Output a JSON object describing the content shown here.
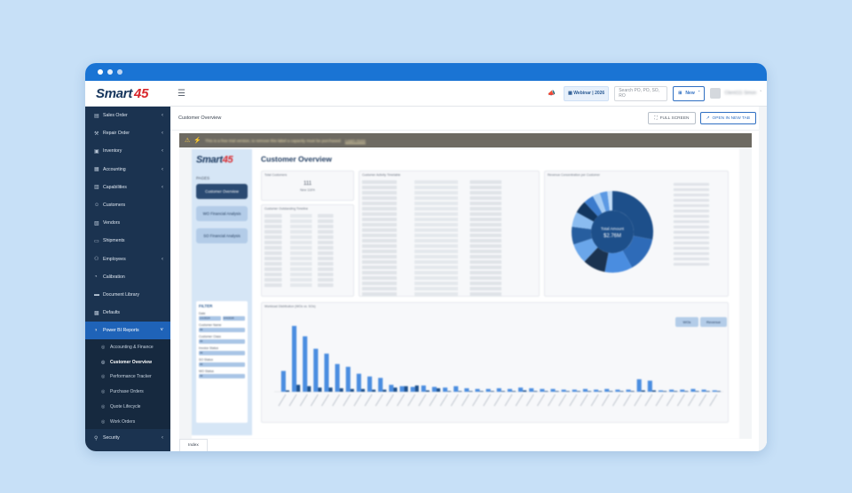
{
  "topbar": {
    "logo_text": "Smart",
    "logo_accent": "45",
    "menu_icon": "hamburger-icon",
    "webinar_label": "Webinar | 2026",
    "search_placeholder": "Search PO, PO, SO, RO",
    "new_label": "New",
    "user_name": "Client111 Simon"
  },
  "sidebar": {
    "items": [
      {
        "label": "Sales Order",
        "icon": "cart-icon",
        "expandable": true
      },
      {
        "label": "Repair Order",
        "icon": "wrench-icon",
        "expandable": true
      },
      {
        "label": "Inventory",
        "icon": "box-icon",
        "expandable": true
      },
      {
        "label": "Accounting",
        "icon": "calculator-icon",
        "expandable": true
      },
      {
        "label": "Capabilities",
        "icon": "clipboard-icon",
        "expandable": true
      },
      {
        "label": "Customers",
        "icon": "people-icon",
        "expandable": false
      },
      {
        "label": "Vendors",
        "icon": "store-icon",
        "expandable": false
      },
      {
        "label": "Shipments",
        "icon": "truck-icon",
        "expandable": false
      },
      {
        "label": "Employees",
        "icon": "users-icon",
        "expandable": true
      },
      {
        "label": "Calibration",
        "icon": "gauge-icon",
        "expandable": false
      },
      {
        "label": "Document Library",
        "icon": "folder-icon",
        "expandable": false
      },
      {
        "label": "Defaults",
        "icon": "grid-icon",
        "expandable": false
      },
      {
        "label": "Power BI Reports",
        "icon": "chart-icon",
        "expandable": true
      }
    ],
    "sub_items": [
      "Accounting & Finance",
      "Customer Overview",
      "Performance Tracker",
      "Purchase Orders",
      "Quote Lifecycle",
      "Work Orders"
    ],
    "footer_item": "Security"
  },
  "main": {
    "page_title": "Customer Overview",
    "fullscreen_label": "FULL SCREEN",
    "open_new_tab_label": "OPEN IN NEW TAB",
    "banner_text": "This is a free trial version, to remove this label a capacity must be purchased.",
    "banner_link": "Learn more",
    "tab_label": "Index"
  },
  "report": {
    "logo_text": "Smart",
    "logo_accent": "45",
    "title": "Customer Overview",
    "pages_label": "PAGES",
    "pages": [
      "Customer Overview",
      "WO Financial Analysis",
      "SO Financial Analysis"
    ],
    "filter_title": "FILTER",
    "filters": [
      {
        "label": "Date",
        "value": "All"
      },
      {
        "label": "Customer Name",
        "value": "All"
      },
      {
        "label": "Customer Class",
        "value": "All"
      },
      {
        "label": "Invoice Status",
        "value": "All"
      },
      {
        "label": "SO Status",
        "value": "All"
      },
      {
        "label": "WO Status",
        "value": "All"
      }
    ],
    "date_from": "1/1/2024",
    "date_to": "6/4/2026",
    "card_titles": [
      "Total Customers",
      "Customer Activity Timetable",
      "Revenue Concentration per Customer",
      "Customer Outstanding Timeline",
      "Workload Distribution (WOs vs. SOs)"
    ],
    "kpi_value": "111",
    "kpi_sub": "New 116%",
    "donut_center_label": "Total Amount",
    "donut_center_value": "$2.76M",
    "toggle_labels": [
      "WOs",
      "Revenue"
    ]
  },
  "chart_data": [
    {
      "type": "pie",
      "title": "Revenue Concentration per Customer",
      "values": [
        28,
        14,
        11,
        9,
        8,
        7,
        6,
        5,
        4,
        3,
        3,
        2
      ]
    },
    {
      "type": "bar",
      "title": "Workload Distribution (WOs vs. SOs)",
      "series": [
        {
          "values": [
            30,
            95,
            80,
            62,
            55,
            40,
            36,
            26,
            22,
            20,
            10,
            8,
            7,
            9,
            7,
            6,
            8,
            5,
            4,
            4,
            5,
            4,
            6,
            5,
            4,
            4,
            3,
            3,
            4,
            3,
            4,
            3,
            3,
            18,
            16,
            2,
            3,
            3,
            4,
            3,
            2
          ]
        },
        {
          "values": [
            2,
            10,
            8,
            6,
            6,
            5,
            4,
            4,
            3,
            3,
            6,
            8,
            9,
            2,
            5,
            1,
            1,
            1,
            1,
            1,
            1,
            1,
            2,
            1,
            1,
            1,
            1,
            1,
            1,
            1,
            1,
            1,
            1,
            2,
            2,
            1,
            1,
            1,
            1,
            1,
            1
          ]
        }
      ]
    }
  ],
  "colors": {
    "titlebar": "#1a74d4",
    "sidebar": "#1b3350",
    "accent": "#1f63b8",
    "bar_primary": "#4a8de0",
    "bar_secondary": "#1d4f8a"
  }
}
